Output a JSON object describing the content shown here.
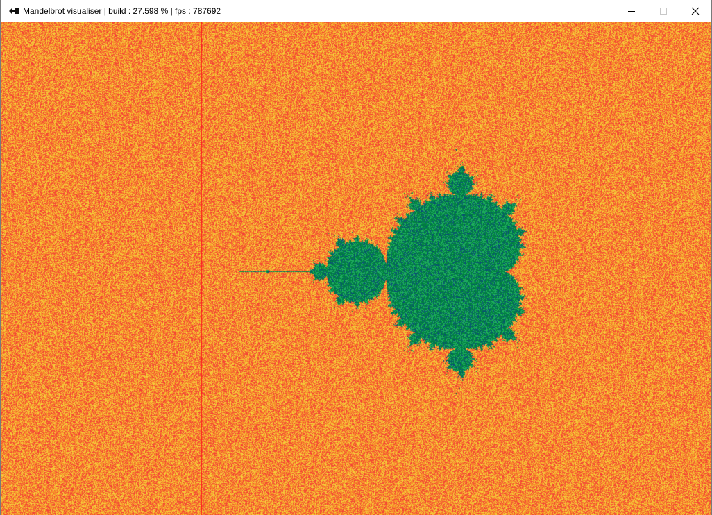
{
  "window": {
    "title": "Mandelbrot visualiser | build : 27.598 % | fps : 787692",
    "app_icon": "arrow-icon",
    "controls": {
      "minimize_icon": "minimize-icon",
      "maximize_icon": "maximize-icon",
      "close_icon": "close-icon"
    }
  },
  "render": {
    "build_progress_percent": 27.598,
    "colors": {
      "outside_base": "#f7902a",
      "outside_hot": "#f44236",
      "outside_light": "#f5d23c",
      "inside_base": "#00803f",
      "inside_light": "#20b060",
      "inside_dark": "#0a4a7a",
      "scan_line": "#ff1a1a"
    }
  }
}
